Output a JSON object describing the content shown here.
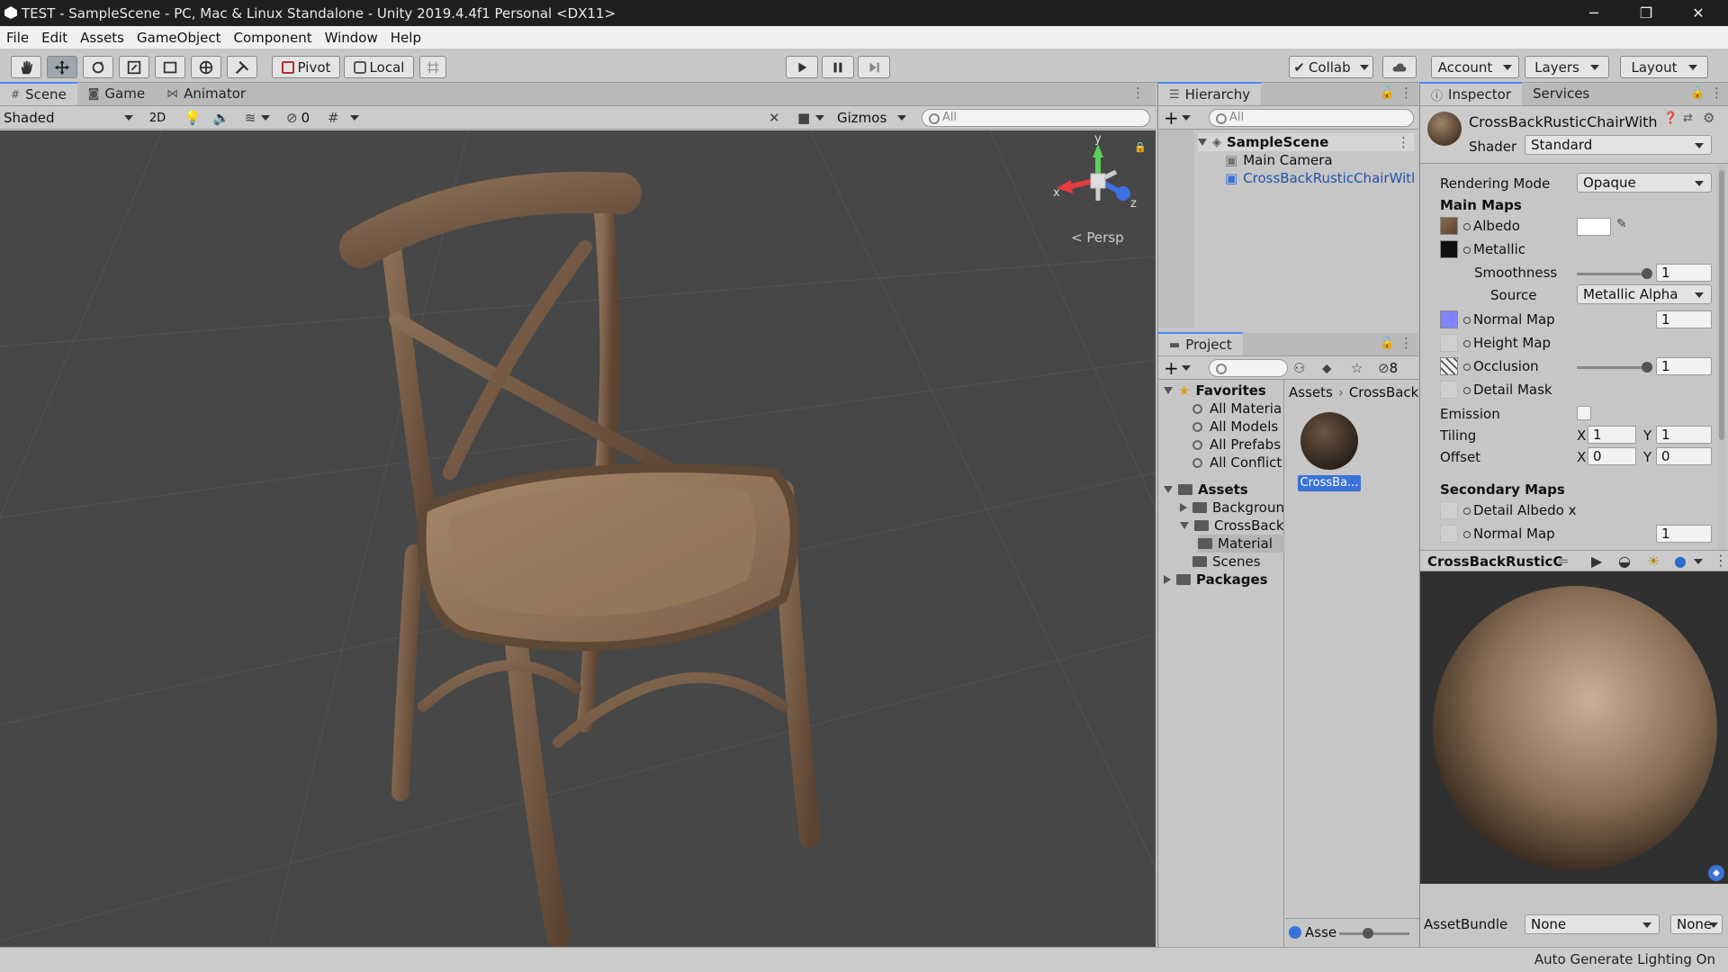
{
  "window": {
    "title": "TEST - SampleScene - PC, Mac & Linux Standalone - Unity 2019.4.4f1 Personal <DX11>",
    "minimize": "─",
    "maximize": "❐",
    "close": "✕"
  },
  "menu": [
    "File",
    "Edit",
    "Assets",
    "GameObject",
    "Component",
    "Window",
    "Help"
  ],
  "toolbar": {
    "pivot": "Pivot",
    "local": "Local",
    "collab": "Collab",
    "account": "Account",
    "layers": "Layers",
    "layout": "Layout"
  },
  "scene_tabs": [
    "Scene",
    "Game",
    "Animator"
  ],
  "scene_bar": {
    "shading": "Shaded",
    "mode_2d": "2D",
    "hidden_count": "0",
    "gizmos": "Gizmos",
    "search_placeholder": "All"
  },
  "gizmo": {
    "y": "y",
    "x": "x",
    "z": "z",
    "projection": "Persp"
  },
  "hierarchy": {
    "title": "Hierarchy",
    "search_placeholder": "All",
    "scene": "SampleScene",
    "items": [
      "Main Camera",
      "CrossBackRusticChairWith"
    ]
  },
  "project": {
    "title": "Project",
    "hidden_count": "8",
    "favorites_label": "Favorites",
    "favorites": [
      "All Materia",
      "All Models",
      "All Prefabs",
      "All Conflict"
    ],
    "assets_label": "Assets",
    "assets_children": [
      "Backgroun",
      "CrossBack"
    ],
    "crossback_children": [
      "Material"
    ],
    "scenes": "Scenes",
    "packages": "Packages",
    "breadcrumb": [
      "Assets",
      "CrossBack"
    ],
    "grid_item": "CrossBa...",
    "footer_label": "Asse"
  },
  "inspector": {
    "tab": "Inspector",
    "services_tab": "Services",
    "object_name": "CrossBackRusticChairWith",
    "shader_label": "Shader",
    "shader_value": "Standard",
    "rendering_mode_label": "Rendering Mode",
    "rendering_mode_value": "Opaque",
    "main_maps": "Main Maps",
    "albedo": "Albedo",
    "metallic": "Metallic",
    "smoothness": "Smoothness",
    "smoothness_value": "1",
    "source": "Source",
    "source_value": "Metallic Alpha",
    "normal_map": "Normal Map",
    "normal_value": "1",
    "height_map": "Height Map",
    "occlusion": "Occlusion",
    "occlusion_value": "1",
    "detail_mask": "Detail Mask",
    "emission": "Emission",
    "tiling": "Tiling",
    "tiling_x_label": "X",
    "tiling_x": "1",
    "tiling_y_label": "Y",
    "tiling_y": "1",
    "offset": "Offset",
    "offset_x_label": "X",
    "offset_x": "0",
    "offset_y_label": "Y",
    "offset_y": "0",
    "secondary_maps": "Secondary Maps",
    "detail_albedo": "Detail Albedo x",
    "secondary_normal": "Normal Map",
    "secondary_normal_value": "1",
    "preview_name": "CrossBackRusticC",
    "assetbundle_label": "AssetBundle",
    "assetbundle_value": "None",
    "assetbundle_variant": "None"
  },
  "status_bar": "Auto Generate Lighting On",
  "colors": {
    "accent": "#4b8cf3",
    "selection": "#3a72d8",
    "scene_bg": "#474747"
  }
}
